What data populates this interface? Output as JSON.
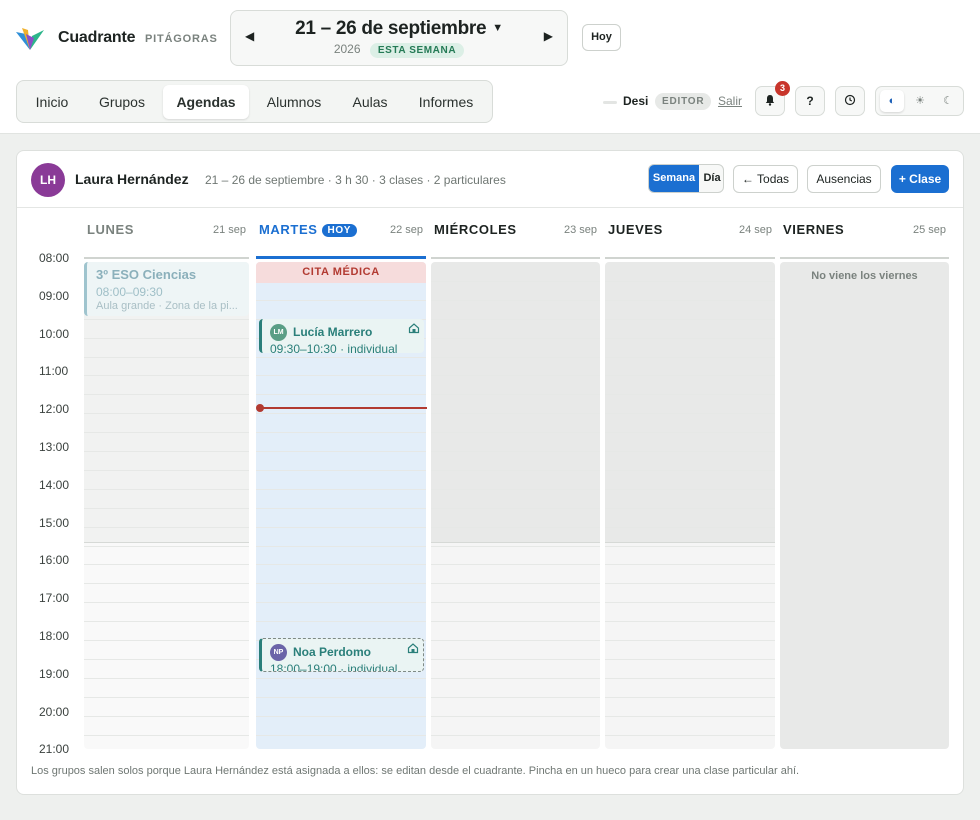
{
  "header": {
    "app_name": "Cuadrante",
    "school": "PITÁGORAS",
    "range_title": "21 – 26 de septiembre",
    "year": "2026",
    "week_badge": "ESTA SEMANA",
    "today_button": "Hoy"
  },
  "nav": {
    "tabs": [
      {
        "label": "Inicio",
        "active": false
      },
      {
        "label": "Grupos",
        "active": false
      },
      {
        "label": "Agendas",
        "active": true
      },
      {
        "label": "Alumnos",
        "active": false
      },
      {
        "label": "Aulas",
        "active": false
      },
      {
        "label": "Informes",
        "active": false
      }
    ]
  },
  "user": {
    "name": "Desi",
    "role": "EDITOR",
    "logout": "Salir",
    "notifications": "3",
    "help": "?"
  },
  "icons": {
    "prev": "chevron-left-icon",
    "next": "chevron-right-icon",
    "bell": "bell-icon",
    "settings": "clock-icon",
    "themes": [
      "contrast-icon",
      "sun-icon",
      "moon-icon"
    ]
  },
  "colors": {
    "accent": "#1b6fd1",
    "absence": "#b23a31",
    "private_class": "#2a7f7a",
    "avatar": "#8a3a97"
  },
  "agenda": {
    "avatar_initials": "LH",
    "teacher": "Laura Hernández",
    "meta": "21 – 26 de septiembre · 3 h 30 · 3 clases · 2 particulares",
    "view_week": "Semana",
    "view_day": "Día",
    "all_button": "← Todas",
    "absences_button": "Ausencias",
    "new_class_button": "+ Clase",
    "today_badge": "HOY",
    "days": [
      {
        "name": "LUNES",
        "date": "21 sep"
      },
      {
        "name": "MARTES",
        "date": "22 sep"
      },
      {
        "name": "MIÉRCOLES",
        "date": "23 sep"
      },
      {
        "name": "JUEVES",
        "date": "24 sep"
      },
      {
        "name": "VIERNES",
        "date": "25 sep"
      }
    ],
    "hours": [
      "08:00",
      "09:00",
      "10:00",
      "11:00",
      "12:00",
      "13:00",
      "14:00",
      "15:00",
      "16:00",
      "17:00",
      "18:00",
      "19:00",
      "20:00",
      "21:00"
    ],
    "absence_label": "CITA MÉDICA",
    "friday_note": "No viene los viernes",
    "group_class": {
      "title": "3º ESO Ciencias",
      "time": "08:00–09:30",
      "room": "Aula grande · Zona de la pi..."
    },
    "private_classes": [
      {
        "initials": "LM",
        "student": "Lucía Marrero",
        "time": "09:30–10:30 · individual",
        "avatar_color": "#5a9e86"
      },
      {
        "initials": "NP",
        "student": "Noa Perdomo",
        "time": "18:00–19:00 · individual",
        "avatar_color": "#6a64a8"
      }
    ],
    "footnote": "Los grupos salen solos porque Laura Hernández está asignada a ellos: se editan desde el cuadrante. Pincha en un hueco para crear una clase particular ahí."
  }
}
